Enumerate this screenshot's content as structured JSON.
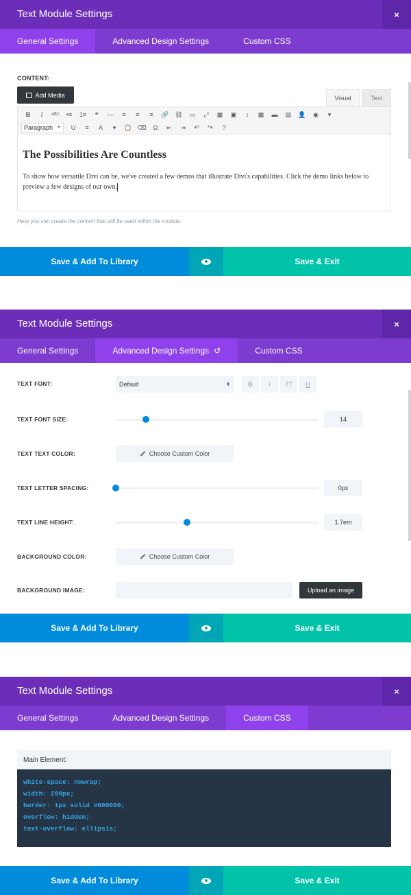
{
  "title": "Text Module Settings",
  "close": "×",
  "tabs": {
    "general": "General Settings",
    "advanced": "Advanced Design Settings",
    "css": "Custom CSS",
    "undo_icon": "↺"
  },
  "footer": {
    "save_library": "Save & Add To Library",
    "save_exit": "Save & Exit"
  },
  "colors": {
    "header": "#6c2eb9",
    "tabs": "#7e3bd0",
    "active_tab": "#8f42ec",
    "save_library": "#008bdb",
    "preview": "#00a5b6",
    "save_exit": "#00c3aa"
  },
  "general": {
    "content_label": "CONTENT:",
    "add_media": "Add Media",
    "editor_tabs": {
      "visual": "Visual",
      "text": "Text"
    },
    "format_select": "Paragraph",
    "toolbar_row1": [
      "B",
      "I",
      "ABC",
      "•≡",
      "1≡",
      "❝",
      "—",
      "≡",
      "≡",
      "≡",
      "🔗",
      "⛓",
      "▭",
      "⤢",
      "▦",
      "▣",
      "↕",
      "▦",
      "▬",
      "▤",
      "👤",
      "◉",
      "▾"
    ],
    "toolbar_row2": [
      "U",
      "≡",
      "A",
      "▾",
      "📋",
      "⌫",
      "Ω",
      "⇤",
      "⇥",
      "↶",
      "↷",
      "?"
    ],
    "heading": "The Possibilities Are Countless",
    "body": "To show how versatile Divi can be, we've created a few demos that illustrate Divi's capabilities. Click the demo links below to preview a few designs of our own.",
    "hint": "Here you can create the content that will be used within the module."
  },
  "advanced": {
    "text_font_label": "TEXT FONT:",
    "text_font_value": "Default",
    "font_buttons": [
      "B",
      "I",
      "TT",
      "U"
    ],
    "text_font_size_label": "TEXT FONT SIZE:",
    "text_font_size_value": "14",
    "text_font_size_level": 0.15,
    "text_color_label": "TEXT TEXT COLOR:",
    "choose_color": "Choose Custom Color",
    "letter_spacing_label": "TEXT LETTER SPACING:",
    "letter_spacing_value": "0px",
    "letter_spacing_level": 0.0,
    "line_height_label": "TEXT LINE HEIGHT:",
    "line_height_value": "1.7em",
    "line_height_level": 0.35,
    "bg_color_label": "BACKGROUND COLOR:",
    "bg_image_label": "BACKGROUND IMAGE:",
    "upload_image": "Upload an image"
  },
  "css": {
    "main_element_label": "Main Element:",
    "code_lines": [
      "white-space: nowrap;",
      "width: 200px;",
      "border: 1px solid #000000;",
      "overflow: hidden;",
      "text-overflow: ellipsis;"
    ]
  }
}
